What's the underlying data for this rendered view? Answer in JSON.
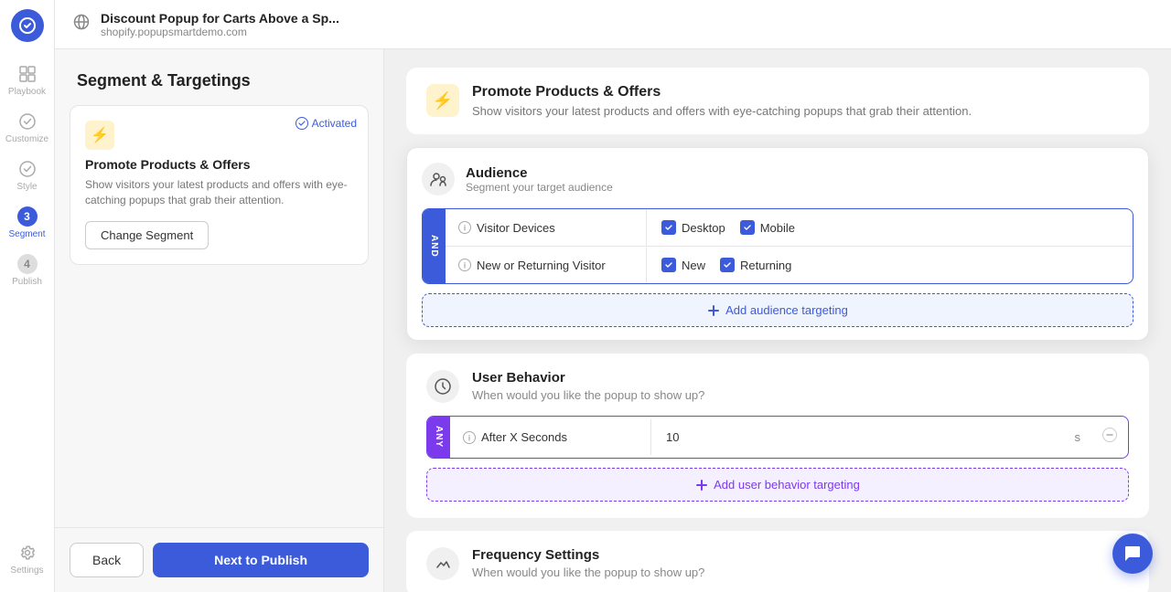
{
  "header": {
    "title": "Discount Popup for Carts Above a Sp...",
    "url": "shopify.popupsmartdemo.com"
  },
  "nav": {
    "items": [
      {
        "label": "Playbook",
        "icon": "grid",
        "active": false
      },
      {
        "label": "Customize",
        "icon": "brush",
        "active": false
      },
      {
        "label": "Style",
        "icon": "check",
        "active": false
      },
      {
        "label": "Segment",
        "icon": "3",
        "active": true
      },
      {
        "label": "Publish",
        "icon": "4",
        "active": false
      }
    ],
    "settings_label": "Settings"
  },
  "sidebar": {
    "title": "Segment & Targetings",
    "card": {
      "activated_label": "Activated",
      "icon": "⚡",
      "title": "Promote Products & Offers",
      "description": "Show visitors your latest products and offers with eye-catching popups that grab their attention.",
      "change_button": "Change Segment"
    },
    "back_button": "Back",
    "next_button": "Next to Publish"
  },
  "main": {
    "campaign": {
      "icon": "⚡",
      "title": "Promote Products & Offers",
      "description": "Show visitors your latest products and offers with eye-catching popups that grab their attention."
    },
    "audience": {
      "title": "Audience",
      "subtitle": "Segment your target audience",
      "badge": "AND",
      "rows": [
        {
          "label": "Visitor Devices",
          "options": [
            {
              "label": "Desktop",
              "checked": true
            },
            {
              "label": "Mobile",
              "checked": true
            }
          ]
        },
        {
          "label": "New or Returning Visitor",
          "options": [
            {
              "label": "New",
              "checked": true
            },
            {
              "label": "Returning",
              "checked": true
            }
          ]
        }
      ],
      "add_button": "Add audience targeting"
    },
    "user_behavior": {
      "title": "User Behavior",
      "subtitle": "When would you like the popup to show up?",
      "badge": "ANY",
      "rows": [
        {
          "label": "After X Seconds",
          "value": "10",
          "unit": "s"
        }
      ],
      "add_button": "Add user behavior targeting"
    },
    "frequency": {
      "title": "Frequency Settings",
      "subtitle": "When would you like the popup to show up?"
    }
  },
  "chat": {
    "icon": "💬"
  }
}
